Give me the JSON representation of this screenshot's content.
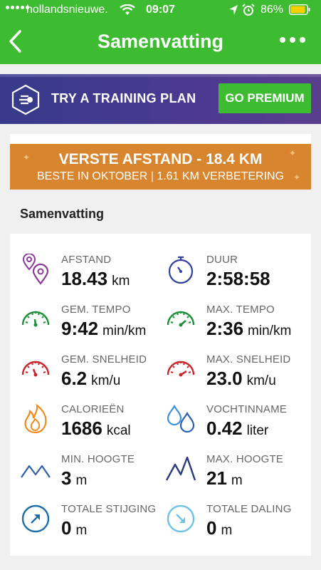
{
  "status_bar": {
    "carrier": "hollandsnieuwe.",
    "time": "09:07",
    "battery": "86%"
  },
  "header": {
    "title": "Samenvatting"
  },
  "premium": {
    "plan_text": "TRY A TRAINING PLAN",
    "button_label": "GO PREMIUM"
  },
  "record": {
    "title": "VERSTE AFSTAND - 18.4 KM",
    "subtitle": "BESTE IN OKTOBER  |  1.61 KM VERBETERING"
  },
  "summary": {
    "section_title": "Samenvatting",
    "stats": [
      {
        "label": "AFSTAND",
        "value": "18.43",
        "unit": "km",
        "icon": "location-pins-icon"
      },
      {
        "label": "DUUR",
        "value": "2:58:58",
        "unit": "",
        "icon": "stopwatch-icon"
      },
      {
        "label": "GEM. TEMPO",
        "value": "9:42",
        "unit": "min/km",
        "icon": "pace-gauge-icon"
      },
      {
        "label": "MAX. TEMPO",
        "value": "2:36",
        "unit": "min/km",
        "icon": "pace-gauge-icon"
      },
      {
        "label": "GEM. SNELHEID",
        "value": "6.2",
        "unit": "km/u",
        "icon": "speed-gauge-icon"
      },
      {
        "label": "MAX. SNELHEID",
        "value": "23.0",
        "unit": "km/u",
        "icon": "speed-gauge-icon"
      },
      {
        "label": "CALORIEËN",
        "value": "1686",
        "unit": "kcal",
        "icon": "flame-icon"
      },
      {
        "label": "VOCHTINNAME",
        "value": "0.42",
        "unit": "liter",
        "icon": "water-drops-icon"
      },
      {
        "label": "MIN. HOOGTE",
        "value": "3",
        "unit": "m",
        "icon": "mountain-low-icon"
      },
      {
        "label": "MAX. HOOGTE",
        "value": "21",
        "unit": "m",
        "icon": "mountain-high-icon"
      },
      {
        "label": "TOTALE STIJGING",
        "value": "0",
        "unit": "m",
        "icon": "ascent-icon"
      },
      {
        "label": "TOTALE DALING",
        "value": "0",
        "unit": "m",
        "icon": "descent-icon"
      }
    ]
  },
  "colors": {
    "brand_green": "#3dbb31",
    "banner_purple": "#3b3a8c",
    "record_orange": "#d7852f",
    "purple_icon": "#8b3a9a",
    "blue_icon": "#2f3f9e",
    "green_icon": "#1e8f3a",
    "red_icon": "#c7282e",
    "orange_icon": "#ef8a1f",
    "lightblue_icon": "#3d8fdc",
    "navy_icon": "#2b3a7a"
  }
}
